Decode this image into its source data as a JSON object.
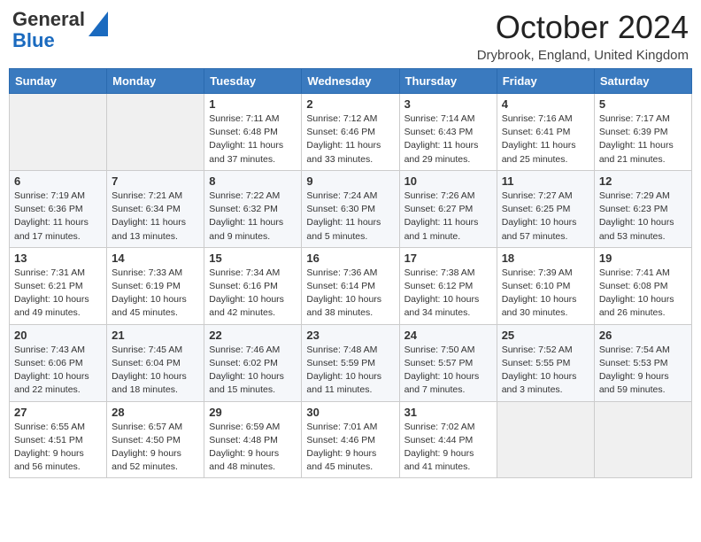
{
  "logo": {
    "general": "General",
    "blue": "Blue"
  },
  "title": "October 2024",
  "location": "Drybrook, England, United Kingdom",
  "weekdays": [
    "Sunday",
    "Monday",
    "Tuesday",
    "Wednesday",
    "Thursday",
    "Friday",
    "Saturday"
  ],
  "weeks": [
    [
      {
        "day": null,
        "info": null
      },
      {
        "day": null,
        "info": null
      },
      {
        "day": "1",
        "info": "Sunrise: 7:11 AM\nSunset: 6:48 PM\nDaylight: 11 hours and 37 minutes."
      },
      {
        "day": "2",
        "info": "Sunrise: 7:12 AM\nSunset: 6:46 PM\nDaylight: 11 hours and 33 minutes."
      },
      {
        "day": "3",
        "info": "Sunrise: 7:14 AM\nSunset: 6:43 PM\nDaylight: 11 hours and 29 minutes."
      },
      {
        "day": "4",
        "info": "Sunrise: 7:16 AM\nSunset: 6:41 PM\nDaylight: 11 hours and 25 minutes."
      },
      {
        "day": "5",
        "info": "Sunrise: 7:17 AM\nSunset: 6:39 PM\nDaylight: 11 hours and 21 minutes."
      }
    ],
    [
      {
        "day": "6",
        "info": "Sunrise: 7:19 AM\nSunset: 6:36 PM\nDaylight: 11 hours and 17 minutes."
      },
      {
        "day": "7",
        "info": "Sunrise: 7:21 AM\nSunset: 6:34 PM\nDaylight: 11 hours and 13 minutes."
      },
      {
        "day": "8",
        "info": "Sunrise: 7:22 AM\nSunset: 6:32 PM\nDaylight: 11 hours and 9 minutes."
      },
      {
        "day": "9",
        "info": "Sunrise: 7:24 AM\nSunset: 6:30 PM\nDaylight: 11 hours and 5 minutes."
      },
      {
        "day": "10",
        "info": "Sunrise: 7:26 AM\nSunset: 6:27 PM\nDaylight: 11 hours and 1 minute."
      },
      {
        "day": "11",
        "info": "Sunrise: 7:27 AM\nSunset: 6:25 PM\nDaylight: 10 hours and 57 minutes."
      },
      {
        "day": "12",
        "info": "Sunrise: 7:29 AM\nSunset: 6:23 PM\nDaylight: 10 hours and 53 minutes."
      }
    ],
    [
      {
        "day": "13",
        "info": "Sunrise: 7:31 AM\nSunset: 6:21 PM\nDaylight: 10 hours and 49 minutes."
      },
      {
        "day": "14",
        "info": "Sunrise: 7:33 AM\nSunset: 6:19 PM\nDaylight: 10 hours and 45 minutes."
      },
      {
        "day": "15",
        "info": "Sunrise: 7:34 AM\nSunset: 6:16 PM\nDaylight: 10 hours and 42 minutes."
      },
      {
        "day": "16",
        "info": "Sunrise: 7:36 AM\nSunset: 6:14 PM\nDaylight: 10 hours and 38 minutes."
      },
      {
        "day": "17",
        "info": "Sunrise: 7:38 AM\nSunset: 6:12 PM\nDaylight: 10 hours and 34 minutes."
      },
      {
        "day": "18",
        "info": "Sunrise: 7:39 AM\nSunset: 6:10 PM\nDaylight: 10 hours and 30 minutes."
      },
      {
        "day": "19",
        "info": "Sunrise: 7:41 AM\nSunset: 6:08 PM\nDaylight: 10 hours and 26 minutes."
      }
    ],
    [
      {
        "day": "20",
        "info": "Sunrise: 7:43 AM\nSunset: 6:06 PM\nDaylight: 10 hours and 22 minutes."
      },
      {
        "day": "21",
        "info": "Sunrise: 7:45 AM\nSunset: 6:04 PM\nDaylight: 10 hours and 18 minutes."
      },
      {
        "day": "22",
        "info": "Sunrise: 7:46 AM\nSunset: 6:02 PM\nDaylight: 10 hours and 15 minutes."
      },
      {
        "day": "23",
        "info": "Sunrise: 7:48 AM\nSunset: 5:59 PM\nDaylight: 10 hours and 11 minutes."
      },
      {
        "day": "24",
        "info": "Sunrise: 7:50 AM\nSunset: 5:57 PM\nDaylight: 10 hours and 7 minutes."
      },
      {
        "day": "25",
        "info": "Sunrise: 7:52 AM\nSunset: 5:55 PM\nDaylight: 10 hours and 3 minutes."
      },
      {
        "day": "26",
        "info": "Sunrise: 7:54 AM\nSunset: 5:53 PM\nDaylight: 9 hours and 59 minutes."
      }
    ],
    [
      {
        "day": "27",
        "info": "Sunrise: 6:55 AM\nSunset: 4:51 PM\nDaylight: 9 hours and 56 minutes."
      },
      {
        "day": "28",
        "info": "Sunrise: 6:57 AM\nSunset: 4:50 PM\nDaylight: 9 hours and 52 minutes."
      },
      {
        "day": "29",
        "info": "Sunrise: 6:59 AM\nSunset: 4:48 PM\nDaylight: 9 hours and 48 minutes."
      },
      {
        "day": "30",
        "info": "Sunrise: 7:01 AM\nSunset: 4:46 PM\nDaylight: 9 hours and 45 minutes."
      },
      {
        "day": "31",
        "info": "Sunrise: 7:02 AM\nSunset: 4:44 PM\nDaylight: 9 hours and 41 minutes."
      },
      {
        "day": null,
        "info": null
      },
      {
        "day": null,
        "info": null
      }
    ]
  ]
}
